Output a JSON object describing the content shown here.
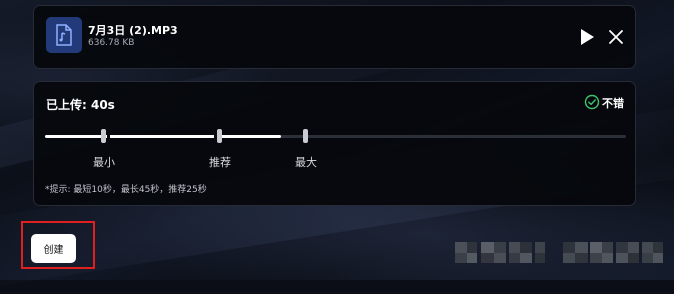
{
  "file": {
    "name": "7月3日 (2).MP3",
    "size": "636.78 KB",
    "icon": "audio-file-icon",
    "play_icon": "play-icon",
    "close_icon": "close-icon"
  },
  "duration": {
    "uploaded_label": "已上传: 40s",
    "rating_label": "不错",
    "rating_icon": "check-circle-icon",
    "rating_color": "#3ec46d",
    "value_seconds": 40,
    "min_seconds": 10,
    "recommended_seconds": 25,
    "max_seconds": 45,
    "marks": {
      "min": "最小",
      "recommended": "推荐",
      "max": "最大"
    },
    "hint": "*提示: 最短10秒，最长45秒，推荐25秒"
  },
  "actions": {
    "create_label": "创建",
    "highlight_color": "#e01f1f"
  }
}
